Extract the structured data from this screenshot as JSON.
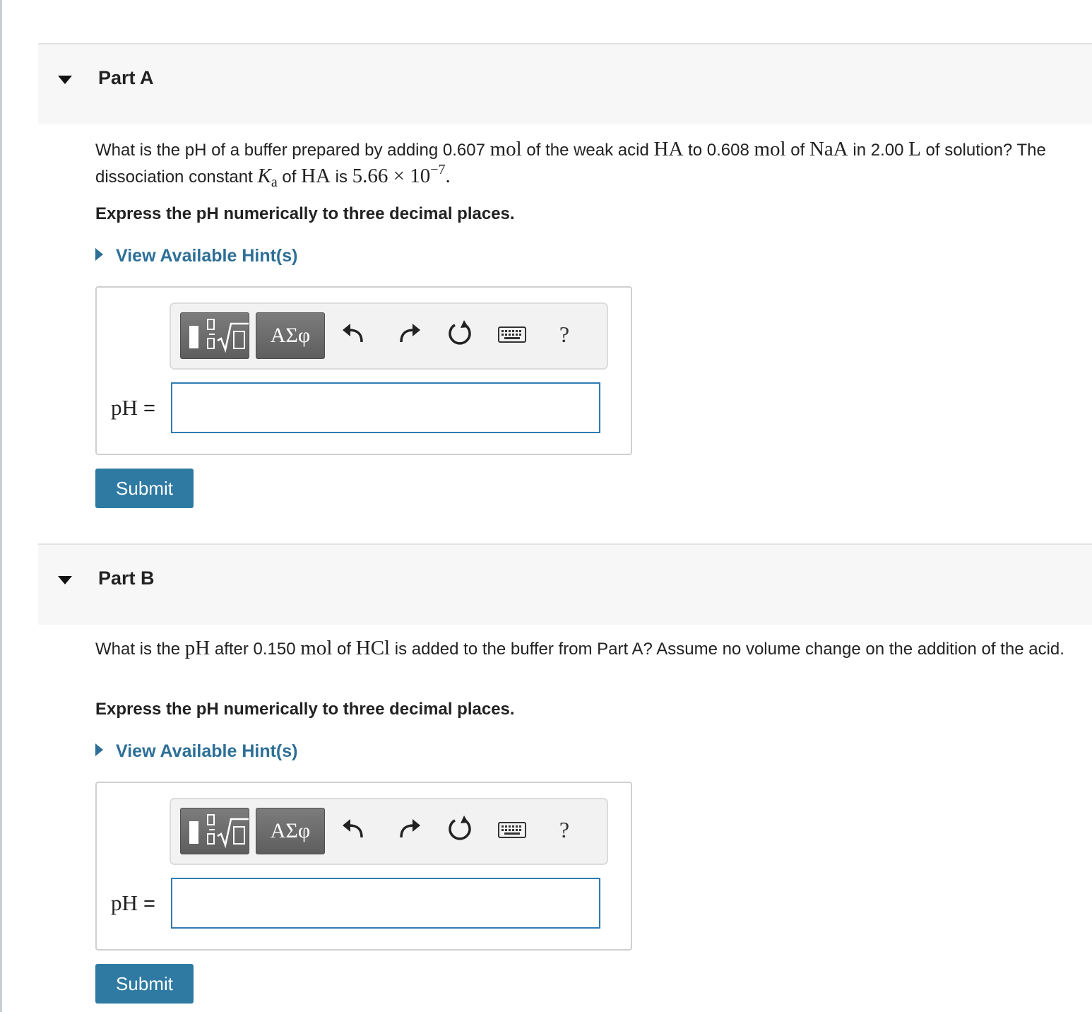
{
  "parts": [
    {
      "title": "Part A",
      "question": {
        "t1": "What is the pH of a buffer prepared by adding 0.607 ",
        "m1": "mol",
        "t2": " of the weak acid ",
        "m2": "HA",
        "t3": " to 0.608 ",
        "m3": "mol",
        "t4": " of ",
        "m4": "NaA",
        "t5": " in 2.00 ",
        "m5": "L",
        "t6": " of solution? The dissociation constant ",
        "ka_symbol": "K",
        "ka_sub": "a",
        "t7": " of ",
        "m6": "HA",
        "t8": " is ",
        "value": "5.66 × 10",
        "exponent": "−7",
        "t9": "."
      },
      "instruction": "Express the pH numerically to three decimal places.",
      "hint": "View Available Hint(s)",
      "toolbar": {
        "greek": "ΑΣφ",
        "help": "?"
      },
      "answer_label": "pH",
      "answer_eq": " =",
      "answer_value": "",
      "submit": "Submit"
    },
    {
      "title": "Part B",
      "question": {
        "t1": "What is the ",
        "m1": "pH",
        "t2": " after 0.150 ",
        "m2": "mol",
        "t3": " of ",
        "m3": "HCl",
        "t4": " is added to the buffer from Part A? Assume no volume change on the addition of the acid."
      },
      "instruction": "Express the pH numerically to three decimal places.",
      "hint": "View Available Hint(s)",
      "toolbar": {
        "greek": "ΑΣφ",
        "help": "?"
      },
      "answer_label": "pH",
      "answer_eq": " =",
      "answer_value": "",
      "submit": "Submit"
    }
  ]
}
